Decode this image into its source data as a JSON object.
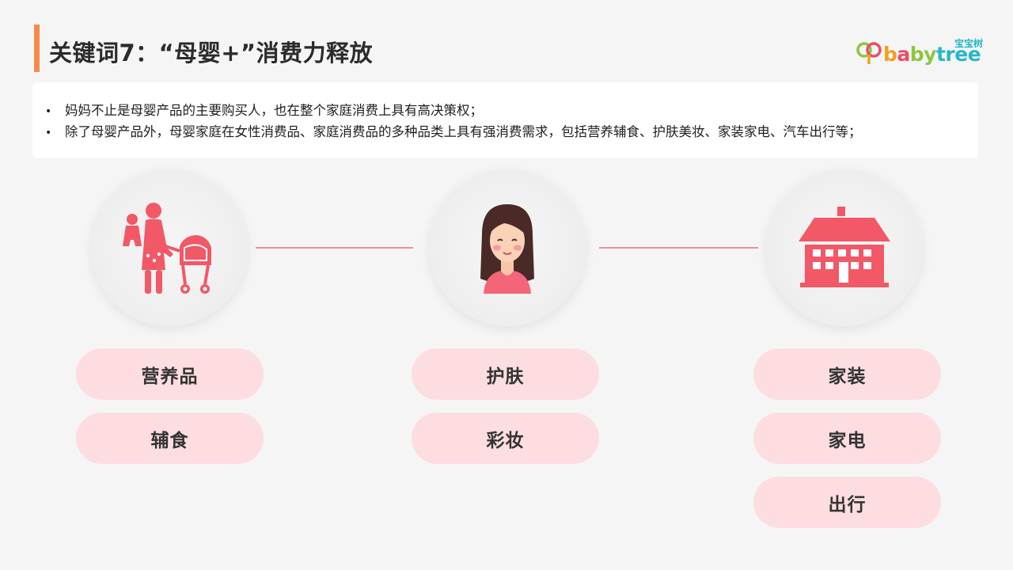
{
  "header": {
    "title": "关键词7：“母婴+”消费力释放"
  },
  "logo": {
    "cn": "宝宝树",
    "word_b": "b",
    "word_a": "a",
    "word_by": "by",
    "word_tree": "tree"
  },
  "info": {
    "bullets": [
      "妈妈不止是母婴产品的主要购买人，也在整个家庭消费上具有高决策权；",
      "除了母婴产品外，母婴家庭在女性消费品、家庭消费品的多种品类上具有强消费需求，包括营养辅食、护肤美妆、家装家电、汽车出行等；"
    ],
    "bullet_symbol": "•"
  },
  "colors": {
    "accent_orange": "#f7894a",
    "icon_red": "#f25866",
    "pill_bg": "#fddde0",
    "connector": "#f28b9a"
  },
  "categories": [
    {
      "icon": "mother-stroller-icon",
      "pills": [
        "营养品",
        "辅食"
      ]
    },
    {
      "icon": "woman-face-icon",
      "pills": [
        "护肤",
        "彩妆"
      ]
    },
    {
      "icon": "house-icon",
      "pills": [
        "家装",
        "家电",
        "出行"
      ]
    }
  ]
}
